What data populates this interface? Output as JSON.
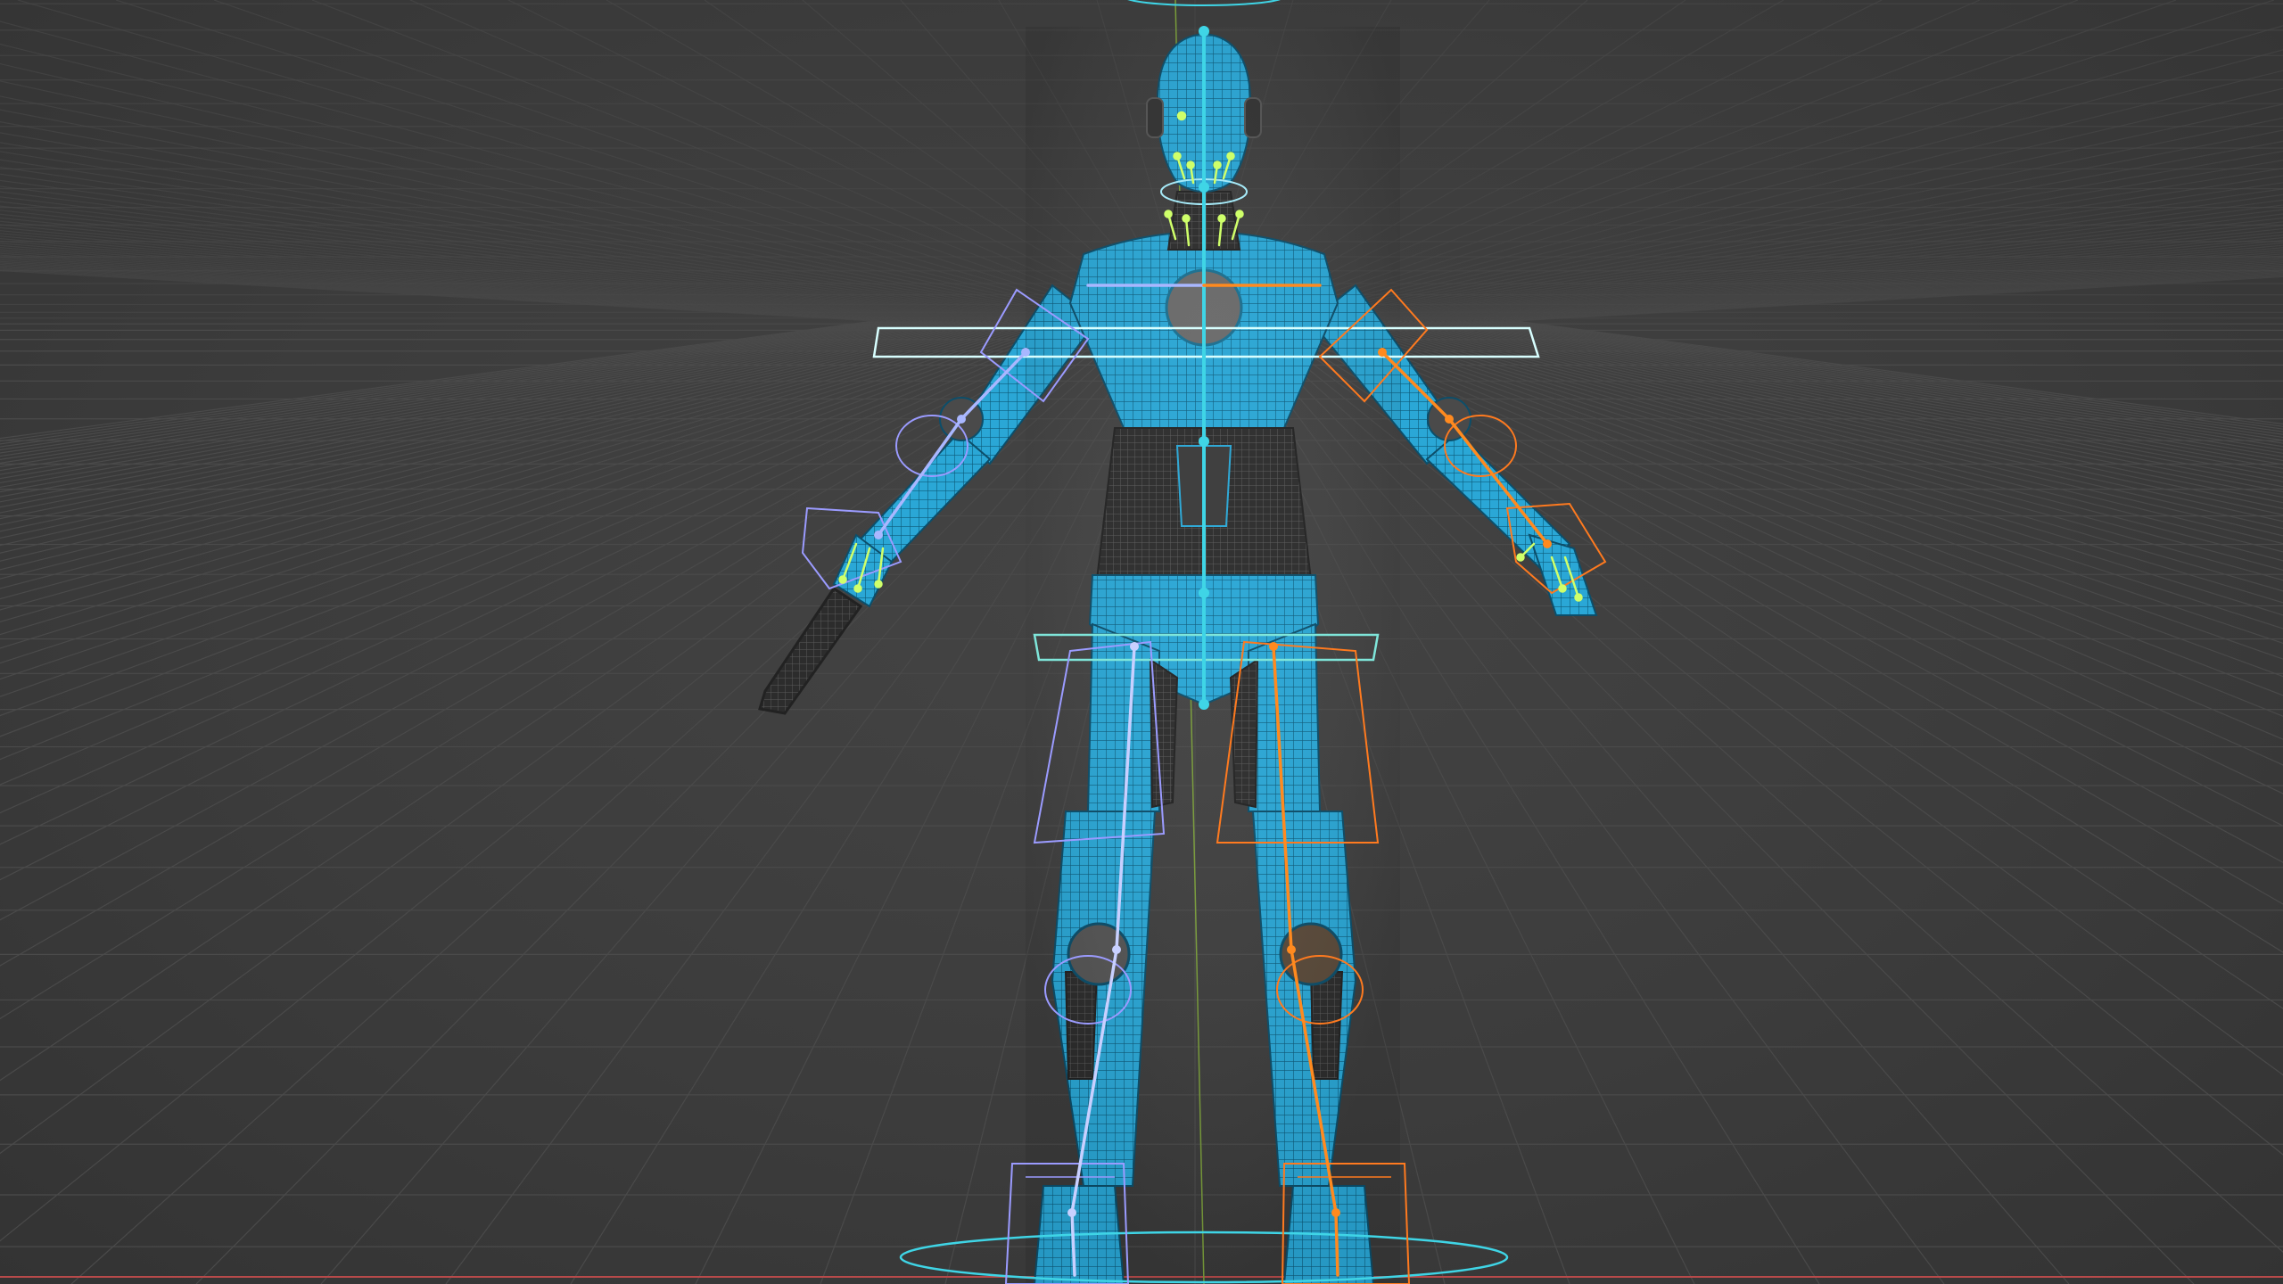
{
  "viewport": {
    "mode": "3D viewport",
    "background_color": "#3b3b3b",
    "grid_color": "#4a4a4a",
    "x_axis_color": "#b84a4a",
    "y_axis_color": "#7a9e3a"
  },
  "model": {
    "mesh_color": "#2aa7d6",
    "mesh_wire_color": "#0c4e6a",
    "dark_mesh_color": "#2e2e2e",
    "bone_center_color": "#3fd5e6",
    "bone_left_color": "#a9b7ff",
    "bone_right_color": "#ff8a1f",
    "facial_bone_color": "#cfff6a"
  },
  "rig_controls": {
    "root_ring_color": "#3fd5e6",
    "chest_plane_color": "#d8ffff",
    "hip_plane_color": "#7fe6da",
    "left_limb_box_color": "#9b9bff",
    "right_limb_box_color": "#ff7a1f"
  }
}
